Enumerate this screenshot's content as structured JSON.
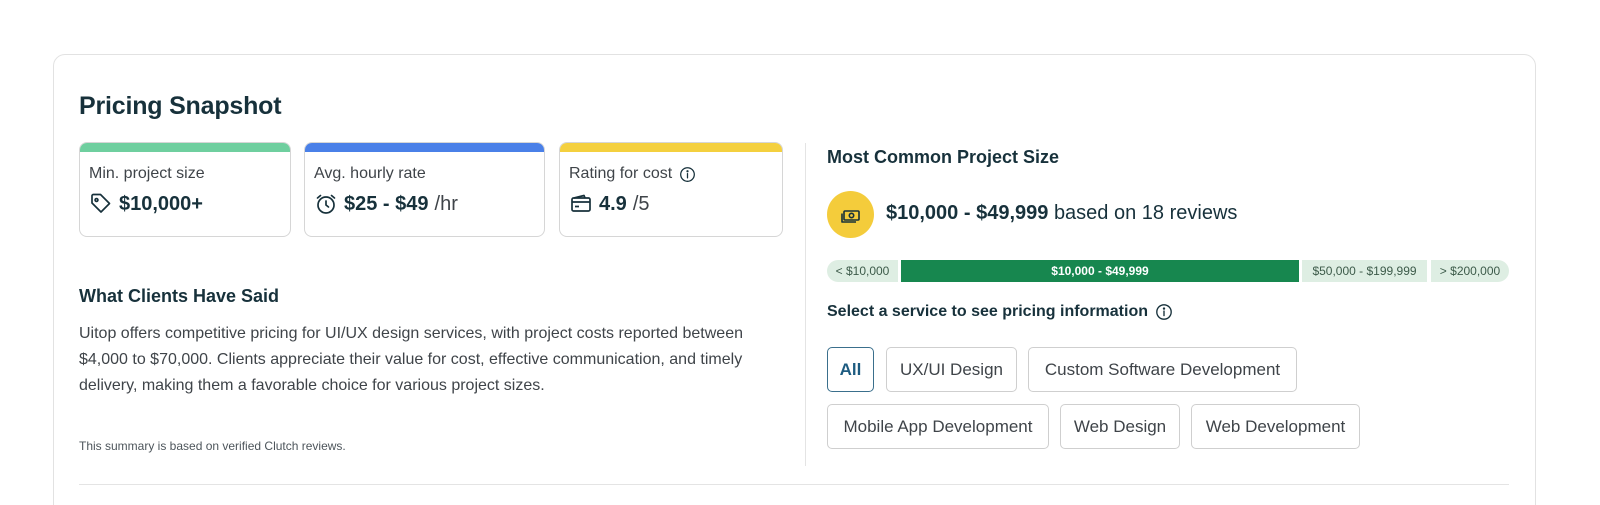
{
  "section": {
    "title": "Pricing Snapshot"
  },
  "stats": [
    {
      "label": "Min. project size",
      "value": "$10,000+",
      "unit": "",
      "icon": "tag-icon",
      "accent": "#6fcf9f"
    },
    {
      "label": "Avg. hourly rate",
      "value": "$25 - $49",
      "unit": "/hr",
      "icon": "alarm-clock-icon",
      "accent": "#4a80e8"
    },
    {
      "label": "Rating for cost",
      "value": "4.9",
      "unit": "/5",
      "icon": "wallet-icon",
      "accent": "#f4d03f",
      "info_icon": "info-icon"
    }
  ],
  "clients": {
    "heading": "What Clients Have Said",
    "summary": "Uitop offers competitive pricing for UI/UX design services, with project costs reported between $4,000 to $70,000. Clients appreciate their value for cost, effective communication, and timely delivery, making them a favorable choice for various project sizes.",
    "note": "This summary is based on verified Clutch reviews."
  },
  "project_size": {
    "heading": "Most Common Project Size",
    "range": "$10,000 - $49,999",
    "range_suffix": "based on 18 reviews",
    "icon": "money-icon",
    "icon_bg": "#f4cc3b",
    "scale": [
      "< $10,000",
      "$10,000 - $49,999",
      "$50,000 - $199,999",
      "> $200,000"
    ],
    "scale_active": "$10,000 - $49,999",
    "active_color": "#17874f"
  },
  "services": {
    "label": "Select a service to see pricing information",
    "selected": "All",
    "items": [
      "All",
      "UX/UI Design",
      "Custom Software Development",
      "Mobile App Development",
      "Web Design",
      "Web Development"
    ]
  }
}
